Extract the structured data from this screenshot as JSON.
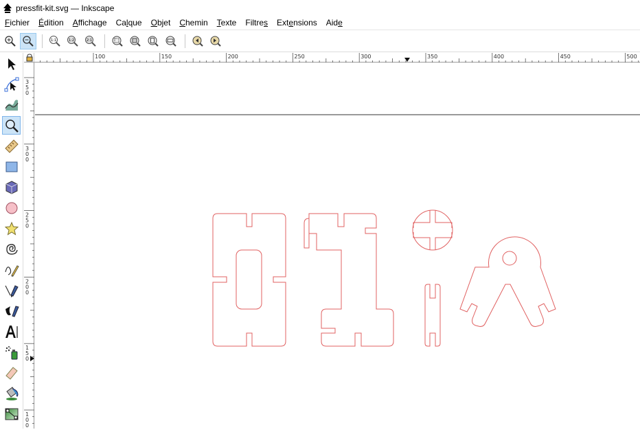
{
  "window": {
    "title": "pressfit-kit.svg — Inkscape"
  },
  "menubar": {
    "items": [
      {
        "pre": "",
        "key": "F",
        "post": "ichier"
      },
      {
        "pre": "",
        "key": "É",
        "post": "dition"
      },
      {
        "pre": "",
        "key": "A",
        "post": "ffichage"
      },
      {
        "pre": "Ca",
        "key": "l",
        "post": "que"
      },
      {
        "pre": "",
        "key": "O",
        "post": "bjet"
      },
      {
        "pre": "",
        "key": "C",
        "post": "hemin"
      },
      {
        "pre": "",
        "key": "T",
        "post": "exte"
      },
      {
        "pre": "Filtre",
        "key": "s",
        "post": ""
      },
      {
        "pre": "Ext",
        "key": "e",
        "post": "nsions"
      },
      {
        "pre": "Aid",
        "key": "e",
        "post": ""
      }
    ]
  },
  "commandbar": {
    "zoom_1_1_label": "1:1",
    "zoom_1_2_label": "1:2",
    "zoom_2_1_label": "2:1"
  },
  "ruler": {
    "h_labels": [
      "100",
      "150",
      "200",
      "250",
      "300",
      "350",
      "400",
      "450",
      "500"
    ],
    "v_labels": [
      "350",
      "300",
      "250",
      "200",
      "150",
      "100"
    ]
  },
  "colors": {
    "path_stroke": "#e06060",
    "accent": "#cce4f7",
    "guide": "#333333"
  }
}
